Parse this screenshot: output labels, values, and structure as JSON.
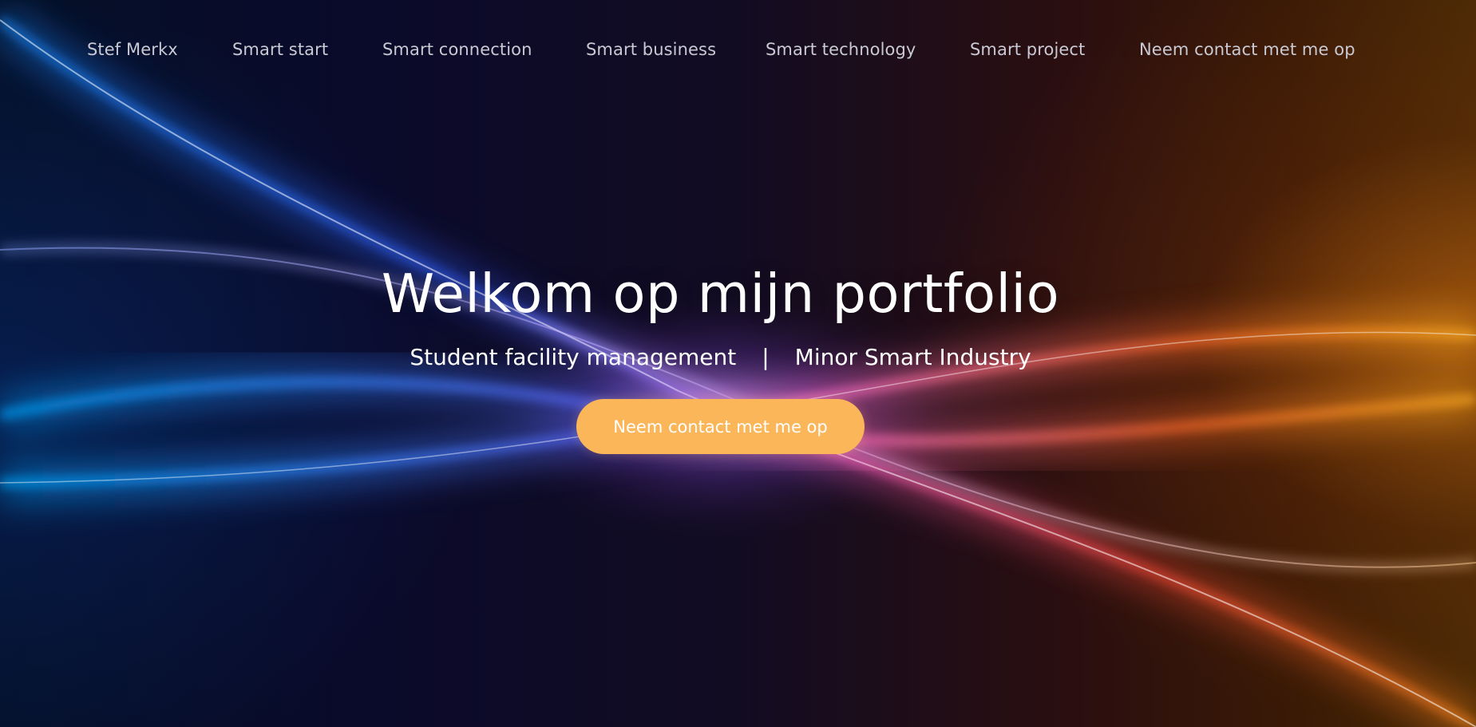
{
  "nav": {
    "brand": "Stef Merkx",
    "items": [
      {
        "label": "Smart start"
      },
      {
        "label": "Smart connection"
      },
      {
        "label": "Smart business"
      },
      {
        "label": "Smart technology"
      },
      {
        "label": "Smart project"
      },
      {
        "label": "Neem contact met me op"
      }
    ]
  },
  "hero": {
    "title": "Welkom op mijn portfolio",
    "subtitle_left": "Student facility management",
    "subtitle_separator": "|",
    "subtitle_right": "Minor Smart Industry",
    "cta_label": "Neem contact met me op"
  },
  "colors": {
    "cta_background": "#fbb65a",
    "nav_text": "#c9c9d4",
    "title_text": "#ffffff",
    "wave_blue": "#2a6bff",
    "wave_violet": "#b36bff",
    "wave_pink": "#ff4fb0",
    "wave_orange": "#ff8a1e"
  }
}
